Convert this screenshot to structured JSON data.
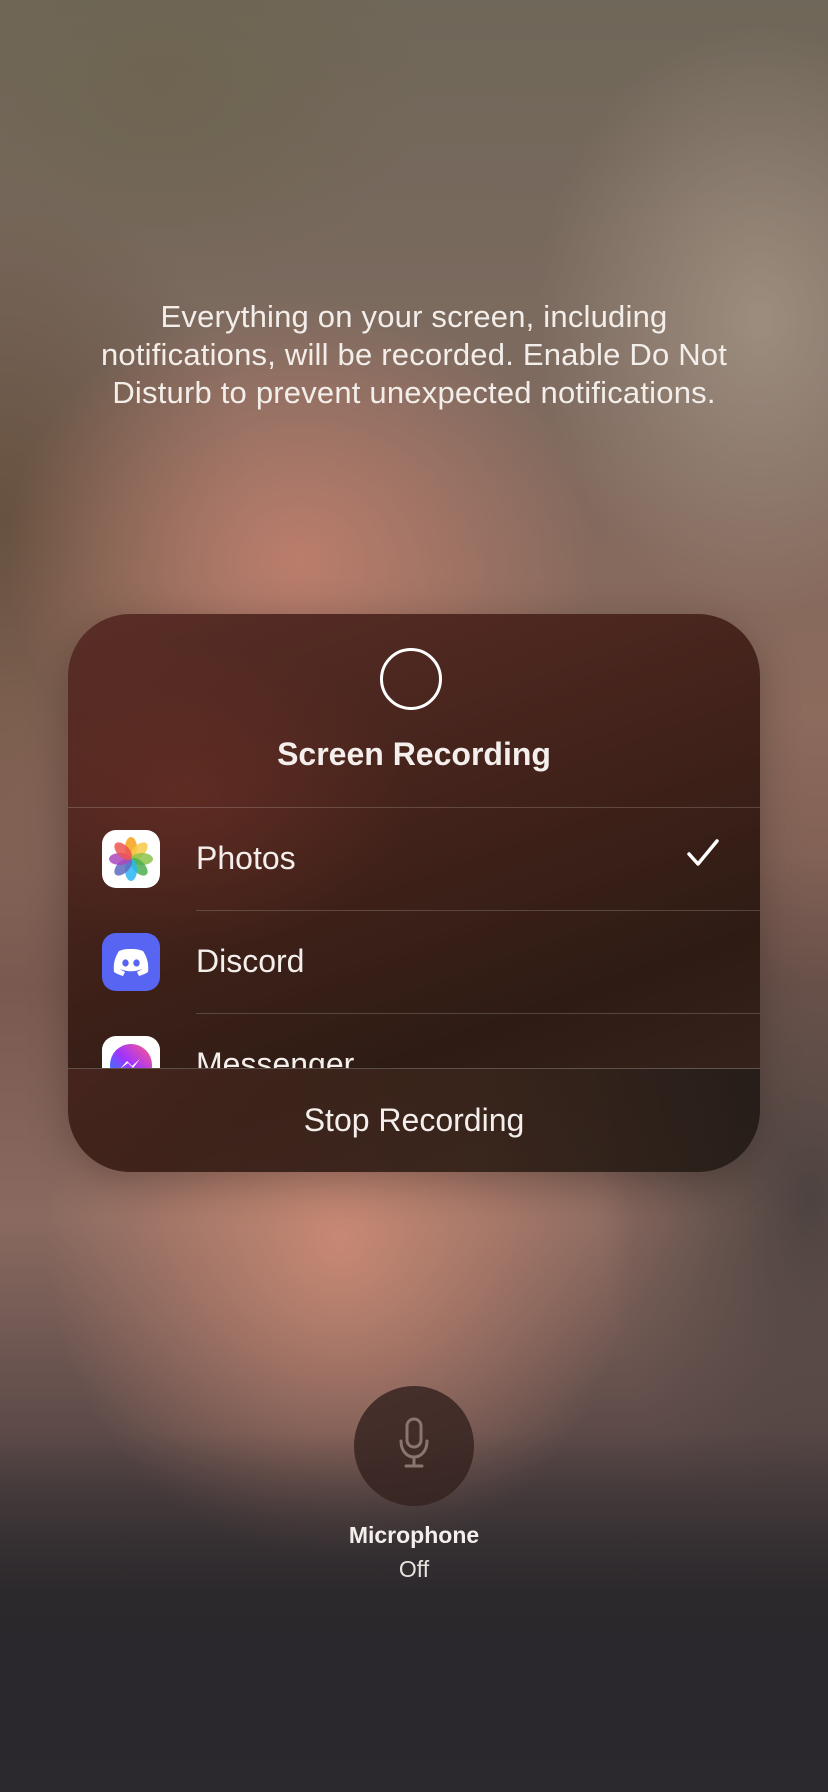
{
  "warning_text": "Everything on your screen, including notifications, will be recorded. Enable Do Not Disturb to prevent unexpected notifications.",
  "panel": {
    "title": "Screen Recording",
    "apps": [
      {
        "label": "Photos",
        "icon": "photos-icon",
        "selected": true
      },
      {
        "label": "Discord",
        "icon": "discord-icon",
        "selected": false
      },
      {
        "label": "Messenger",
        "icon": "messenger-icon",
        "selected": false
      }
    ],
    "stop_label": "Stop Recording"
  },
  "microphone": {
    "label": "Microphone",
    "status": "Off"
  },
  "colors": {
    "discord": "#5865f2",
    "text": "#f4efec"
  }
}
